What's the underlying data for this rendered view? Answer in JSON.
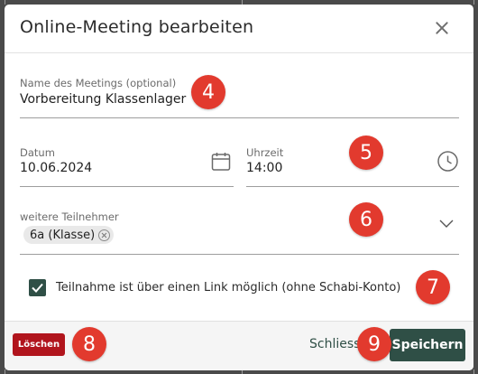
{
  "dialog": {
    "title": "Online-Meeting bearbeiten"
  },
  "meeting_name": {
    "label": "Name des Meetings (optional)",
    "value": "Vorbereitung Klassenlager"
  },
  "date": {
    "label": "Datum",
    "value": "10.06.2024"
  },
  "time": {
    "label": "Uhrzeit",
    "value": "14:00"
  },
  "participants": {
    "label": "weitere Teilnehmer",
    "chips": [
      "6a (Klasse)"
    ]
  },
  "link_option": {
    "label": "Teilnahme ist über einen Link möglich (ohne Schabi-Konto)",
    "checked": true
  },
  "footer": {
    "delete_label": "Löschen",
    "close_label": "Schliess",
    "save_label": "Speichern"
  },
  "markers": [
    "4",
    "5",
    "6",
    "7",
    "8",
    "9"
  ],
  "colors": {
    "primary": "#2f4f46",
    "danger": "#b1151d",
    "marker": "#e23a2e"
  }
}
